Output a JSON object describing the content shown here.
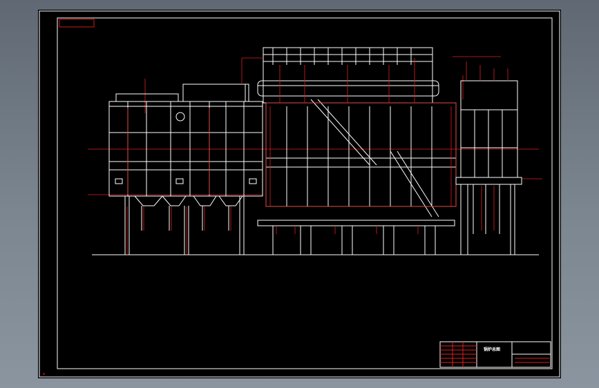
{
  "drawing": {
    "title_block": {
      "drawing_name": "锅炉总图"
    },
    "colors": {
      "background": "#000000",
      "frame": "#cc1a1a",
      "lines_white": "#ffffff",
      "lines_red": "#e02020",
      "app_backdrop": "#7c8690"
    }
  }
}
